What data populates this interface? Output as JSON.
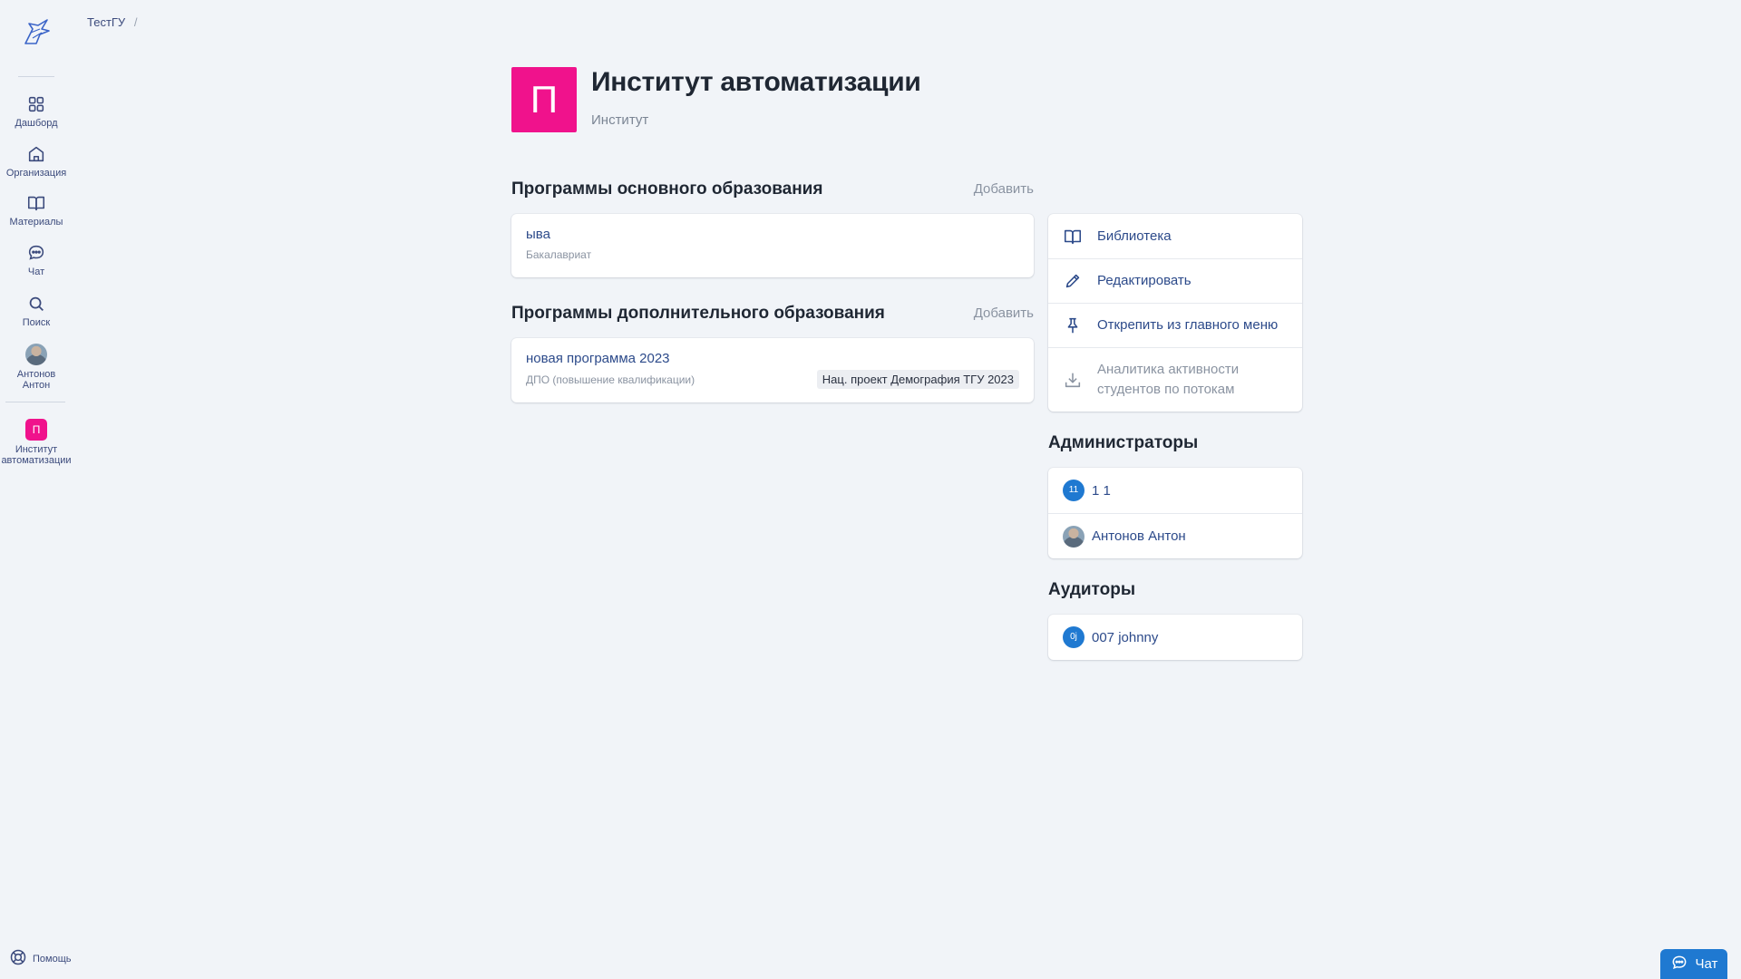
{
  "sidebar": {
    "items": [
      {
        "label": "Дашборд",
        "icon": "grid-icon"
      },
      {
        "label": "Организация",
        "icon": "home-icon"
      },
      {
        "label": "Материалы",
        "icon": "book-icon"
      },
      {
        "label": "Чат",
        "icon": "chat-icon"
      },
      {
        "label": "Поиск",
        "icon": "search-icon"
      },
      {
        "label": "Антонов Антон",
        "icon": "avatar"
      },
      {
        "label": "Институт автоматизации",
        "badge": "П"
      }
    ],
    "help_label": "Помощь"
  },
  "breadcrumb": {
    "root": "ТестГУ",
    "separator": "/"
  },
  "header": {
    "logo_letter": "П",
    "title": "Институт автоматизации",
    "subtitle": "Институт"
  },
  "main_programs": {
    "title": "Программы основного образования",
    "add_label": "Добавить",
    "items": [
      {
        "name": "ыва",
        "type": "Бакалавриат"
      }
    ]
  },
  "extra_programs": {
    "title": "Программы дополнительного образования",
    "add_label": "Добавить",
    "items": [
      {
        "name": "новая программа 2023",
        "type": "ДПО (повышение квалификации)",
        "tag": "Нац. проект Демография ТГУ 2023"
      }
    ]
  },
  "actions": {
    "library": "Библиотека",
    "edit": "Редактировать",
    "unpin": "Открепить из главного меню",
    "analytics": "Аналитика активности студентов по потокам"
  },
  "admins": {
    "title": "Администраторы",
    "items": [
      {
        "initials": "11",
        "name": "1 1"
      },
      {
        "initials": "",
        "name": "Антонов Антон"
      }
    ]
  },
  "auditors": {
    "title": "Аудиторы",
    "items": [
      {
        "initials": "0j",
        "name": "007 johnny"
      }
    ]
  },
  "chat_widget": {
    "label": "Чат"
  },
  "colors": {
    "accent": "#f0128c",
    "link": "#2c4a8a",
    "primary_blue": "#1f79d1"
  }
}
